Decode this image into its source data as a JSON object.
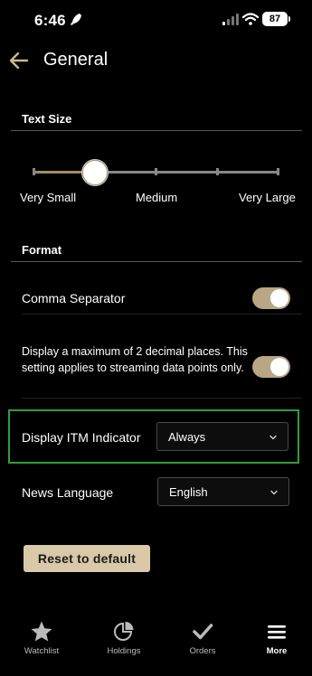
{
  "status_bar": {
    "time": "6:46",
    "battery": "87"
  },
  "header": {
    "title": "General"
  },
  "text_size": {
    "section_label": "Text Size",
    "labels": {
      "small": "Very Small",
      "medium": "Medium",
      "large": "Very Large"
    },
    "selected_step": 1,
    "step_count": 5
  },
  "format": {
    "section_label": "Format",
    "comma_separator": {
      "label": "Comma Separator",
      "enabled": true
    },
    "decimal_places": {
      "label": "Display a maximum of 2 decimal places. This setting applies to streaming data points only.",
      "enabled": true
    },
    "itm_indicator": {
      "label": "Display ITM Indicator",
      "value": "Always"
    },
    "news_language": {
      "label": "News Language",
      "value": "English"
    }
  },
  "reset_button": {
    "label": "Reset to default"
  },
  "nav": {
    "items": [
      {
        "label": "Watchlist",
        "icon": "star-icon"
      },
      {
        "label": "Holdings",
        "icon": "pie-chart-icon"
      },
      {
        "label": "Orders",
        "icon": "checkmark-icon"
      },
      {
        "label": "More",
        "icon": "menu-icon",
        "active": true
      }
    ]
  },
  "colors": {
    "accent": "#b8a684",
    "highlight": "#2f9e3e",
    "button": "#d9c9a8"
  }
}
